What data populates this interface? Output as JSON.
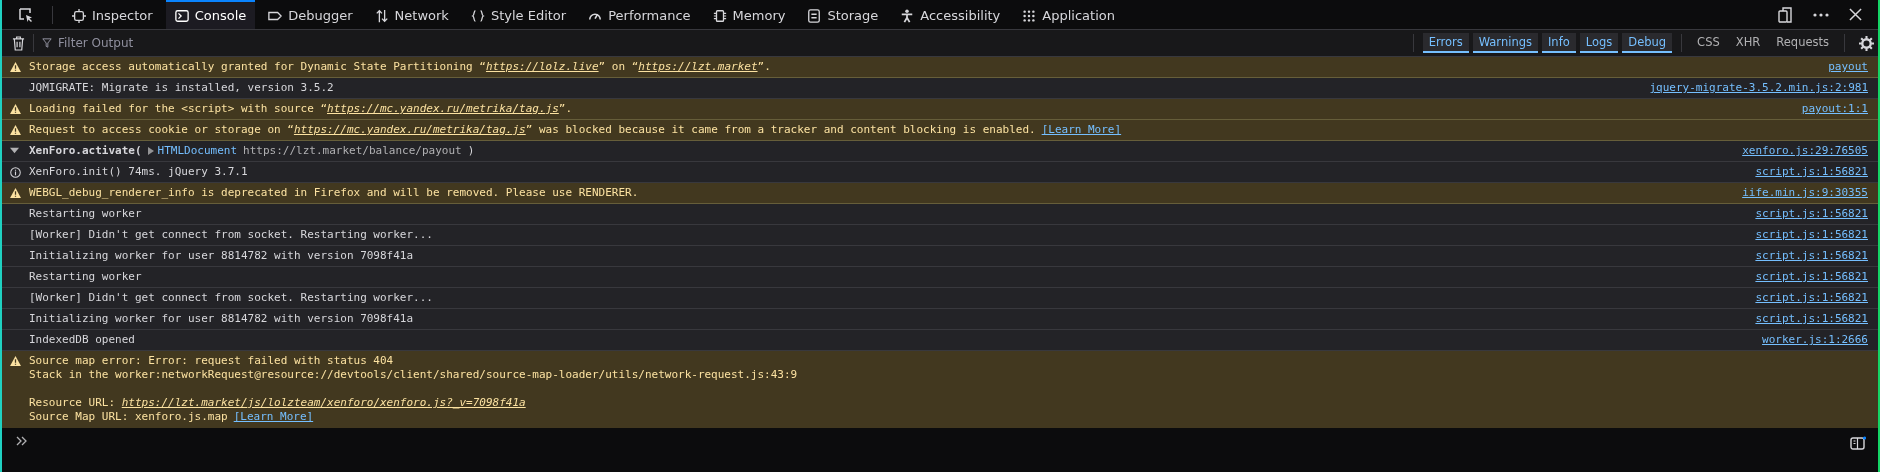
{
  "tabs": [
    {
      "label": "Inspector",
      "selected": false
    },
    {
      "label": "Console",
      "selected": true
    },
    {
      "label": "Debugger",
      "selected": false
    },
    {
      "label": "Network",
      "selected": false
    },
    {
      "label": "Style Editor",
      "selected": false
    },
    {
      "label": "Performance",
      "selected": false
    },
    {
      "label": "Memory",
      "selected": false
    },
    {
      "label": "Storage",
      "selected": false
    },
    {
      "label": "Accessibility",
      "selected": false
    },
    {
      "label": "Application",
      "selected": false
    }
  ],
  "filter": {
    "placeholder": "Filter Output"
  },
  "levels": [
    {
      "label": "Errors",
      "selected": true
    },
    {
      "label": "Warnings",
      "selected": true
    },
    {
      "label": "Info",
      "selected": true
    },
    {
      "label": "Logs",
      "selected": true
    },
    {
      "label": "Debug",
      "selected": true
    }
  ],
  "categories": [
    {
      "label": "CSS",
      "selected": false
    },
    {
      "label": "XHR",
      "selected": false
    },
    {
      "label": "Requests",
      "selected": false
    }
  ],
  "messages": [
    {
      "kind": "warn",
      "lines": [
        {
          "parts": [
            {
              "text": "Storage access automatically granted for Dynamic State Partitioning “"
            },
            {
              "text": "https://lolz.live",
              "link": true
            },
            {
              "text": "” on “"
            },
            {
              "text": "https://lzt.market",
              "link": true
            },
            {
              "text": "”."
            }
          ]
        }
      ],
      "source": "payout"
    },
    {
      "kind": "log",
      "lines": [
        {
          "parts": [
            {
              "text": "JQMIGRATE: Migrate is installed, version 3.5.2"
            }
          ]
        }
      ],
      "source": "jquery-migrate-3.5.2.min.js:2:981"
    },
    {
      "kind": "warn",
      "lines": [
        {
          "parts": [
            {
              "text": "Loading failed for the <script> with source “"
            },
            {
              "text": "https://mc.yandex.ru/metrika/tag.js",
              "link": true
            },
            {
              "text": "”."
            }
          ]
        }
      ],
      "source": "payout:1:1"
    },
    {
      "kind": "warn",
      "lines": [
        {
          "parts": [
            {
              "text": "Request to access cookie or storage on “"
            },
            {
              "text": "https://mc.yandex.ru/metrika/tag.js",
              "link": true
            },
            {
              "text": "” was blocked because it came from a tracker and content blocking is enabled."
            }
          ],
          "learn_more": "[Learn More]"
        }
      ]
    },
    {
      "kind": "group",
      "expanded": true,
      "lines": [
        {
          "parts": [
            {
              "text": "XenForo.activate("
            },
            {
              "text": "HTMLDocument"
            },
            {
              "text": "https://lzt.market/balance/payout"
            },
            {
              "text": ")"
            }
          ]
        }
      ],
      "source": "xenforo.js:29:76505"
    },
    {
      "kind": "info",
      "lines": [
        {
          "parts": [
            {
              "text": "XenForo.init() 74ms. jQuery 3.7.1"
            }
          ]
        }
      ],
      "source": "script.js:1:56821"
    },
    {
      "kind": "warn",
      "lines": [
        {
          "parts": [
            {
              "text": "WEBGL_debug_renderer_info is deprecated in Firefox and will be removed. Please use RENDERER."
            }
          ]
        }
      ],
      "source": "iife.min.js:9:30355"
    },
    {
      "kind": "log",
      "lines": [
        {
          "parts": [
            {
              "text": "Restarting worker"
            }
          ]
        }
      ],
      "source": "script.js:1:56821"
    },
    {
      "kind": "log",
      "lines": [
        {
          "parts": [
            {
              "text": "[Worker] Didn't get connect from socket. Restarting worker..."
            }
          ]
        }
      ],
      "source": "script.js:1:56821"
    },
    {
      "kind": "log",
      "lines": [
        {
          "parts": [
            {
              "text": "Initializing worker for user 8814782 with version 7098f41a"
            }
          ]
        }
      ],
      "source": "script.js:1:56821"
    },
    {
      "kind": "log",
      "lines": [
        {
          "parts": [
            {
              "text": "Restarting worker"
            }
          ]
        }
      ],
      "source": "script.js:1:56821"
    },
    {
      "kind": "log",
      "lines": [
        {
          "parts": [
            {
              "text": "[Worker] Didn't get connect from socket. Restarting worker..."
            }
          ]
        }
      ],
      "source": "script.js:1:56821"
    },
    {
      "kind": "log",
      "lines": [
        {
          "parts": [
            {
              "text": "Initializing worker for user 8814782 with version 7098f41a"
            }
          ]
        }
      ],
      "source": "script.js:1:56821"
    },
    {
      "kind": "log",
      "lines": [
        {
          "parts": [
            {
              "text": "IndexedDB opened"
            }
          ]
        }
      ],
      "source": "worker.js:1:2666"
    },
    {
      "kind": "warn",
      "lines": [
        {
          "parts": [
            {
              "text": "Source map error: Error: request failed with status 404"
            }
          ]
        },
        {
          "parts": [
            {
              "text": "Stack in the worker:networkRequest@resource://devtools/client/shared/source-map-loader/utils/network-request.js:43:9"
            }
          ]
        },
        {
          "gap_before": true,
          "parts": [
            {
              "text": "Resource URL: "
            },
            {
              "text": "https://lzt.market/js/lolzteam/xenforo/xenforo.js?_v=7098f41a",
              "link": true
            }
          ]
        },
        {
          "parts": [
            {
              "text": "Source Map URL: xenforo.js.map"
            }
          ],
          "learn_more": "[Learn More]"
        }
      ]
    }
  ]
}
